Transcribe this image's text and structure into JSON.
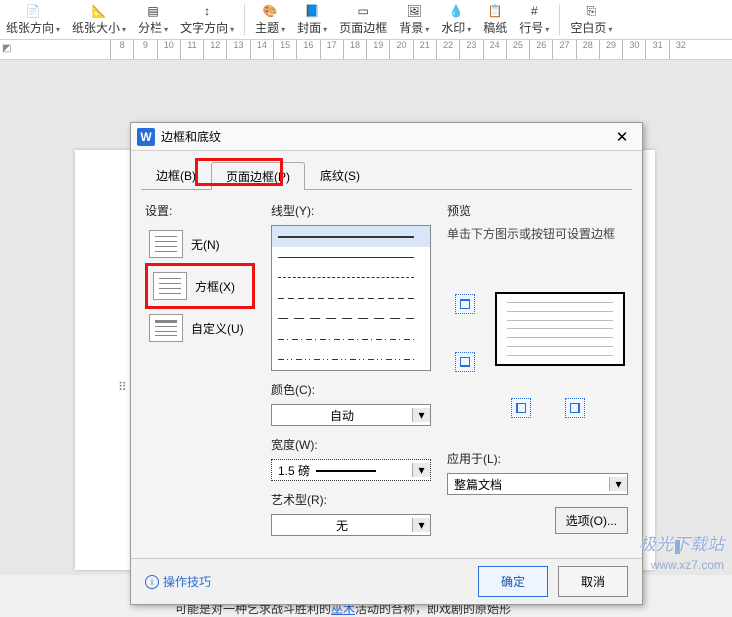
{
  "ribbon": {
    "items": [
      {
        "label": "纸张方向",
        "caret": true
      },
      {
        "label": "纸张大小",
        "caret": true
      },
      {
        "label": "分栏",
        "caret": true
      },
      {
        "label": "文字方向",
        "caret": true
      }
    ],
    "items2": [
      {
        "label": "主题",
        "caret": true
      },
      {
        "label": "封面",
        "caret": true
      },
      {
        "label": "页面边框",
        "caret": false
      },
      {
        "label": "背景",
        "caret": true
      },
      {
        "label": "水印",
        "caret": true
      },
      {
        "label": "稿纸",
        "caret": false
      },
      {
        "label": "行号",
        "caret": true
      }
    ],
    "items3": [
      {
        "label": "空白页",
        "caret": true
      }
    ]
  },
  "ruler": {
    "start": 8,
    "end": 32
  },
  "dialog": {
    "title": "边框和底纹",
    "tabs": {
      "border": "边框(B)",
      "pageBorder": "页面边框(P)",
      "shading": "底纹(S)"
    },
    "settings_label": "设置:",
    "settings": {
      "none": "无(N)",
      "box": "方框(X)",
      "custom": "自定义(U)"
    },
    "line_label": "线型(Y):",
    "color_label": "颜色(C):",
    "color_value": "自动",
    "width_label": "宽度(W):",
    "width_value": "1.5  磅",
    "art_label": "艺术型(R):",
    "art_value": "无",
    "preview_label": "预览",
    "preview_note": "单击下方图示或按钮可设置边框",
    "apply_label": "应用于(L):",
    "apply_value": "整篇文档",
    "options_btn": "选项(O)...",
    "tips": "操作技巧",
    "ok": "确定",
    "cancel": "取消"
  },
  "doc": {
    "text_before": "可能是对一种乞求战斗胜利的",
    "wushu": "巫术",
    "text_after": "活动的合称，即戏剧的原始形"
  },
  "watermark": {
    "name": "极光下载站",
    "url": "www.xz7.com"
  }
}
